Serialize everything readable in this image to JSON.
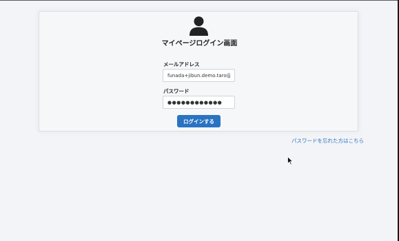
{
  "page": {
    "title": "マイページログイン画面"
  },
  "icons": {
    "user": "user-icon",
    "cursor": "mouse-cursor-icon"
  },
  "form": {
    "email_label": "メールアドレス",
    "email_value": "funada+jibun.demo.taro@sonicmoov.com",
    "password_label": "パスワード",
    "password_value": "●●●●●●●●●●●●",
    "submit_label": "ログインする"
  },
  "links": {
    "forgot_password": "パスワードを忘れた方はこちら"
  },
  "colors": {
    "accent": "#2a73c2",
    "background": "#f3f4f7"
  }
}
